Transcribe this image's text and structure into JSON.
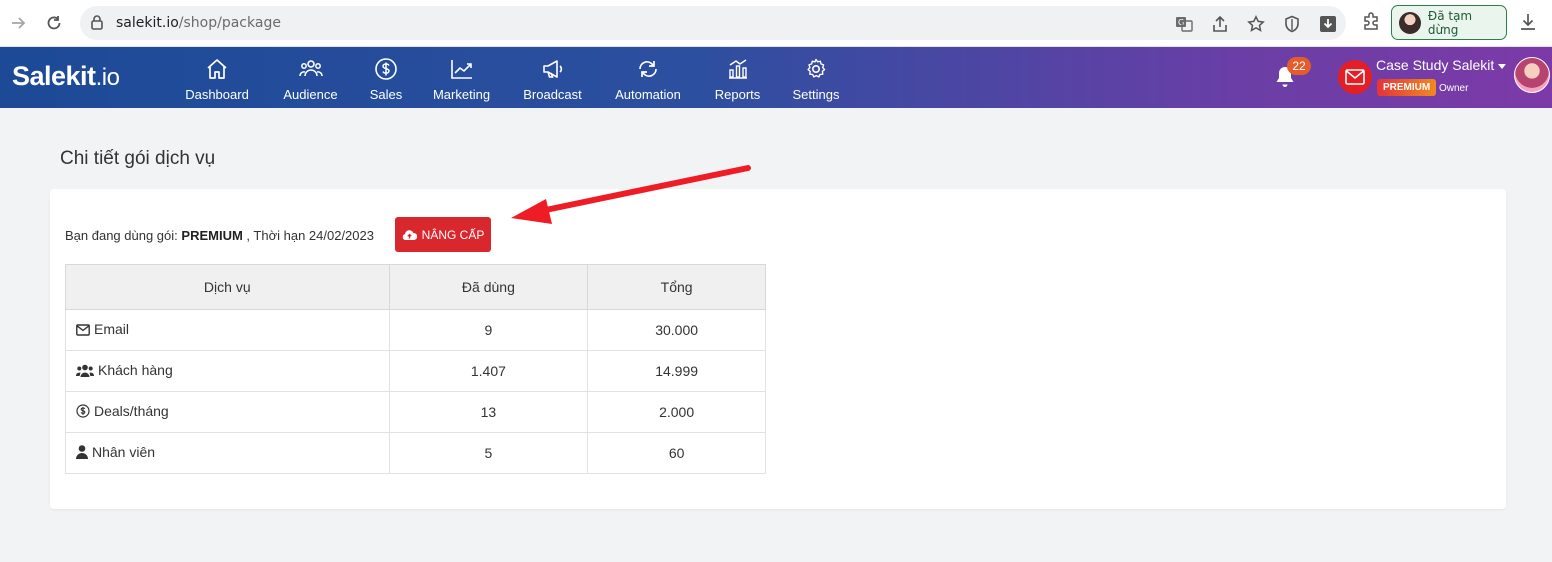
{
  "browser": {
    "url_host": "salekit.io",
    "url_path": "/shop/package",
    "profile_status": "Đã tạm dừng"
  },
  "header": {
    "logo_main": "Salekit",
    "logo_suffix": ".io",
    "menu": [
      {
        "label": "Dashboard",
        "icon": "home-icon"
      },
      {
        "label": "Audience",
        "icon": "users-icon"
      },
      {
        "label": "Sales",
        "icon": "dollar-icon"
      },
      {
        "label": "Marketing",
        "icon": "chart-line-icon"
      },
      {
        "label": "Broadcast",
        "icon": "megaphone-icon"
      },
      {
        "label": "Automation",
        "icon": "repeat-icon"
      },
      {
        "label": "Reports",
        "icon": "bar-chart-icon"
      },
      {
        "label": "Settings",
        "icon": "gear-icon"
      }
    ],
    "notification_count": "22",
    "user_name": "Case Study Salekit",
    "plan_badge": "PREMIUM",
    "role": "Owner",
    "accent_color": "#d9272e"
  },
  "page": {
    "title": "Chi tiết gói dịch vụ",
    "package_prefix": "Bạn đang dùng gói:",
    "package_name": "PREMIUM",
    "expiry_text": ", Thời hạn 24/02/2023",
    "upgrade_label": "NÂNG CẤP"
  },
  "table": {
    "headers": [
      "Dịch vụ",
      "Đã dùng",
      "Tổng"
    ],
    "rows": [
      {
        "icon": "envelope-icon",
        "service": "Email",
        "used": "9",
        "total": "30.000"
      },
      {
        "icon": "users-icon",
        "service": "Khách hàng",
        "used": "1.407",
        "total": "14.999"
      },
      {
        "icon": "dollar-circle-icon",
        "service": "Deals/tháng",
        "used": "13",
        "total": "2.000"
      },
      {
        "icon": "user-icon",
        "service": "Nhân viên",
        "used": "5",
        "total": "60"
      }
    ]
  }
}
